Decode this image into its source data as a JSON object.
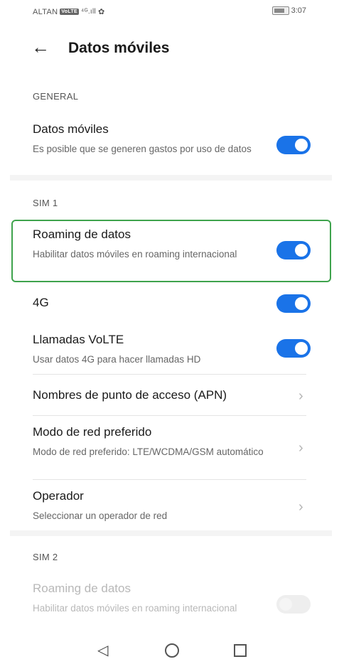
{
  "status_bar": {
    "carrier": "ALTAN",
    "volte_badge": "VoLTE",
    "signal": "⁴ᴳ.ıll",
    "settings_glyph": "✿",
    "time": "3:07"
  },
  "header": {
    "back_glyph": "←",
    "title": "Datos móviles"
  },
  "sections": {
    "general": "GENERAL",
    "sim1": "SIM 1",
    "sim2": "SIM 2"
  },
  "general": {
    "mobile_data": {
      "title": "Datos móviles",
      "subtitle": "Es posible que se generen gastos por uso de datos",
      "enabled": true
    }
  },
  "sim1": {
    "roaming": {
      "title": "Roaming de datos",
      "subtitle": "Habilitar datos móviles en roaming internacional",
      "enabled": true
    },
    "four_g": {
      "title": "4G",
      "enabled": true
    },
    "volte": {
      "title": "Llamadas VoLTE",
      "subtitle": "Usar datos 4G para hacer llamadas HD",
      "enabled": true
    },
    "apn": {
      "title": "Nombres de punto de acceso (APN)"
    },
    "network_mode": {
      "title": "Modo de red preferido",
      "subtitle": "Modo de red preferido: LTE/WCDMA/GSM automático"
    },
    "operator": {
      "title": "Operador",
      "subtitle": "Seleccionar un operador de red"
    }
  },
  "sim2": {
    "roaming": {
      "title": "Roaming de datos",
      "subtitle": "Habilitar datos móviles en roaming internacional",
      "enabled": false
    }
  },
  "chevron_glyph": "›",
  "navbar": {
    "back_glyph": "◁"
  },
  "colors": {
    "toggle_on": "#1a73e8",
    "highlight_border": "#3fa34d"
  }
}
